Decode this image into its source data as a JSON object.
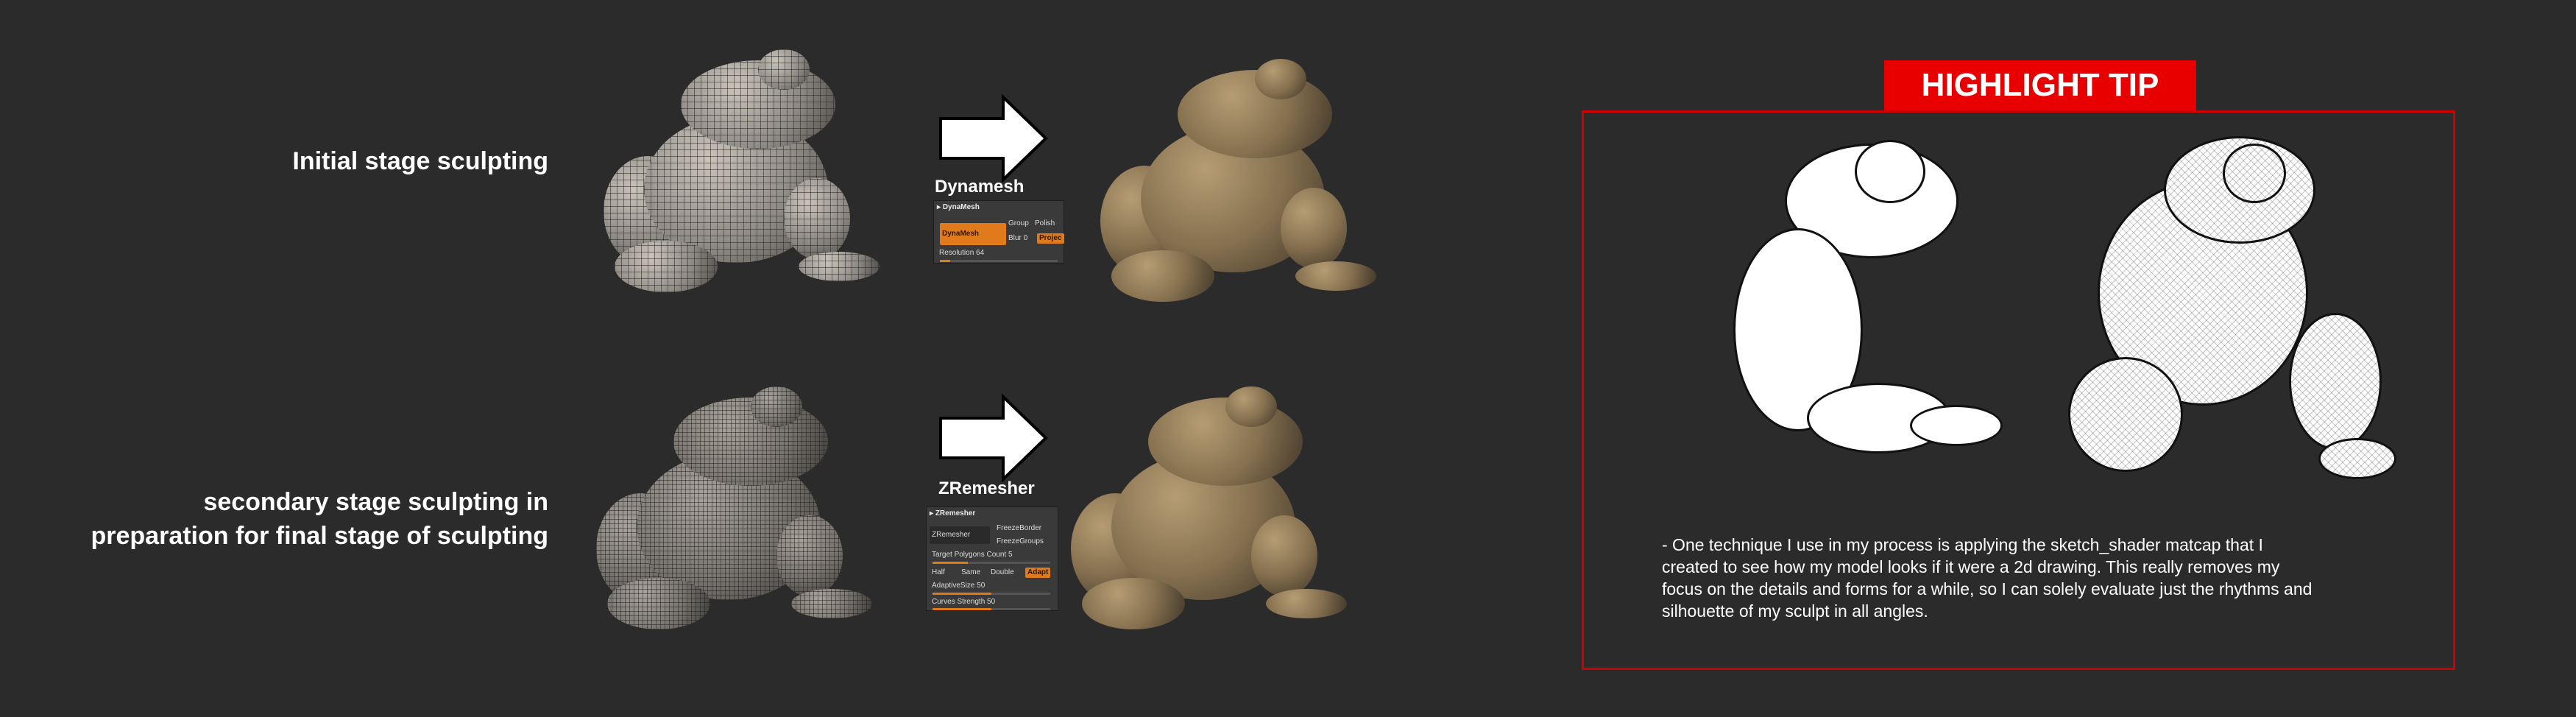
{
  "labels": {
    "initial_stage": "Initial stage sculpting",
    "secondary_line1": "secondary stage sculpting in",
    "secondary_line2": "preparation for final stage of sculpting"
  },
  "dynamesh": {
    "title": "Dynamesh",
    "panel_header": "DynaMesh",
    "button": "DynaMesh",
    "group": "Group",
    "polish": "Polish",
    "blur": "Blur",
    "blur_value": "0",
    "project": "Projec",
    "resolution_label": "Resolution",
    "resolution_value": "64"
  },
  "zremesher": {
    "title": "ZRemesher",
    "panel_header": "ZRemesher",
    "button": "ZRemesher",
    "freeze_border": "FreezeBorder",
    "freeze_groups": "FreezeGroups",
    "target_label": "Target Polygons Count",
    "target_value": "5",
    "half": "Half",
    "same": "Same",
    "double": "Double",
    "adapt": "Adapt",
    "adaptive_label": "AdaptiveSize",
    "adaptive_value": "50",
    "curves_label": "Curves Strength",
    "curves_value": "50",
    "target_fill": 0.3,
    "adaptive_fill": 0.5,
    "curves_fill": 0.5
  },
  "tip": {
    "badge": "HIGHLIGHT TIP",
    "line1": "- One technique I use in my process is applying the sketch_shader matcap that I",
    "line2": "created to see how my model looks if it were a 2d drawing. This really removes my",
    "line3": "focus on the details and forms for a while, so I can solely evaluate just the rhythms and",
    "line4": "silhouette of my sculpt in all angles."
  },
  "colors": {
    "background": "#2b2b2b",
    "badge": "#e80000",
    "frame": "#d00000",
    "zbrush_orange": "#e07a1a"
  }
}
